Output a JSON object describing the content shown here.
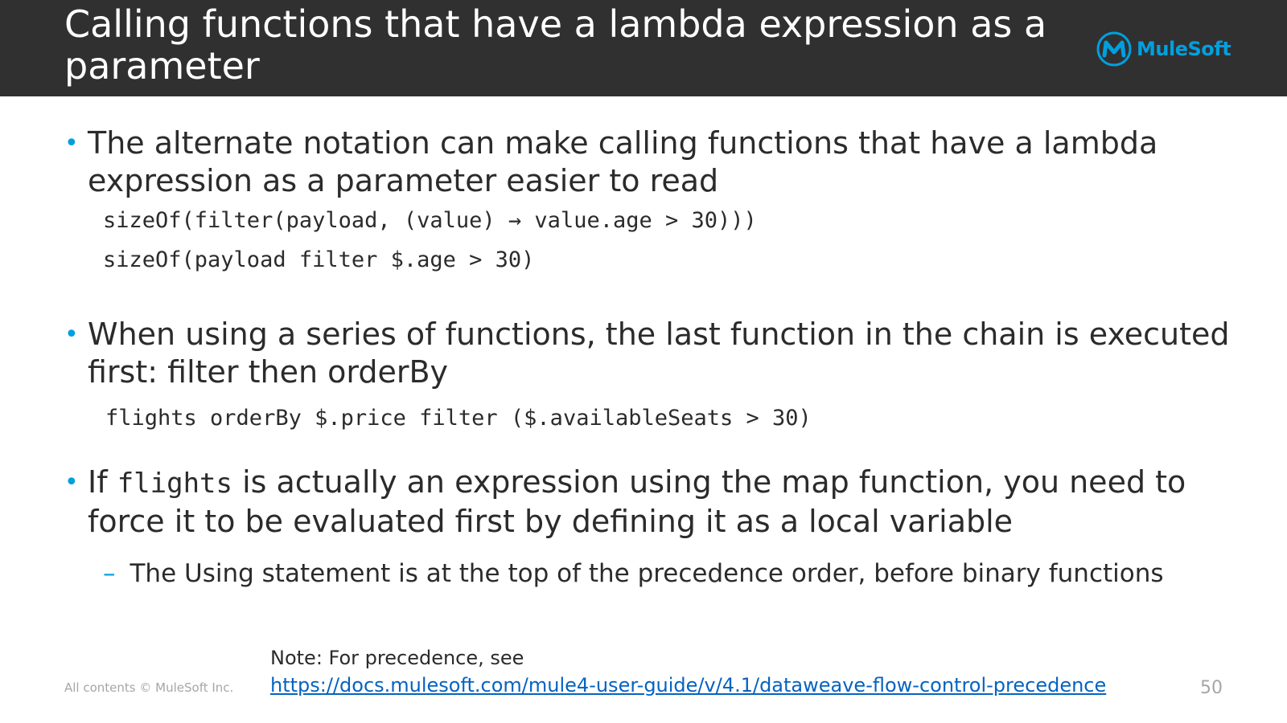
{
  "slide": {
    "title": "Calling functions that have a lambda expression as a parameter",
    "logo_text": "MuleSoft",
    "bullets": [
      {
        "text": "The alternate notation can make calling functions that have a lambda expression as a parameter easier to read",
        "code": [
          "sizeOf(filter(payload, (value) → value.age > 30)))",
          "sizeOf(payload filter $.age > 30)"
        ]
      },
      {
        "text": "When using a series of functions, the last function in the chain is executed first: filter then orderBy",
        "code": [
          "flights orderBy $.price filter ($.availableSeats > 30)"
        ]
      },
      {
        "text_before": "If",
        "inline_code": "flights",
        "text_after": "is actually an expression using the map function, you need to force it to be evaluated first by defining it as a local variable",
        "sub": "The Using statement is at the top of the precedence order, before binary functions"
      }
    ],
    "note_label": "Note: For precedence, see",
    "note_link": "https://docs.mulesoft.com/mule4-user-guide/v/4.1/dataweave-flow-control-precedence",
    "footer": "All contents © MuleSoft Inc.",
    "page_number": "50",
    "colors": {
      "header_bg": "#313030",
      "accent": "#00a0df",
      "link": "#0563c1"
    }
  }
}
